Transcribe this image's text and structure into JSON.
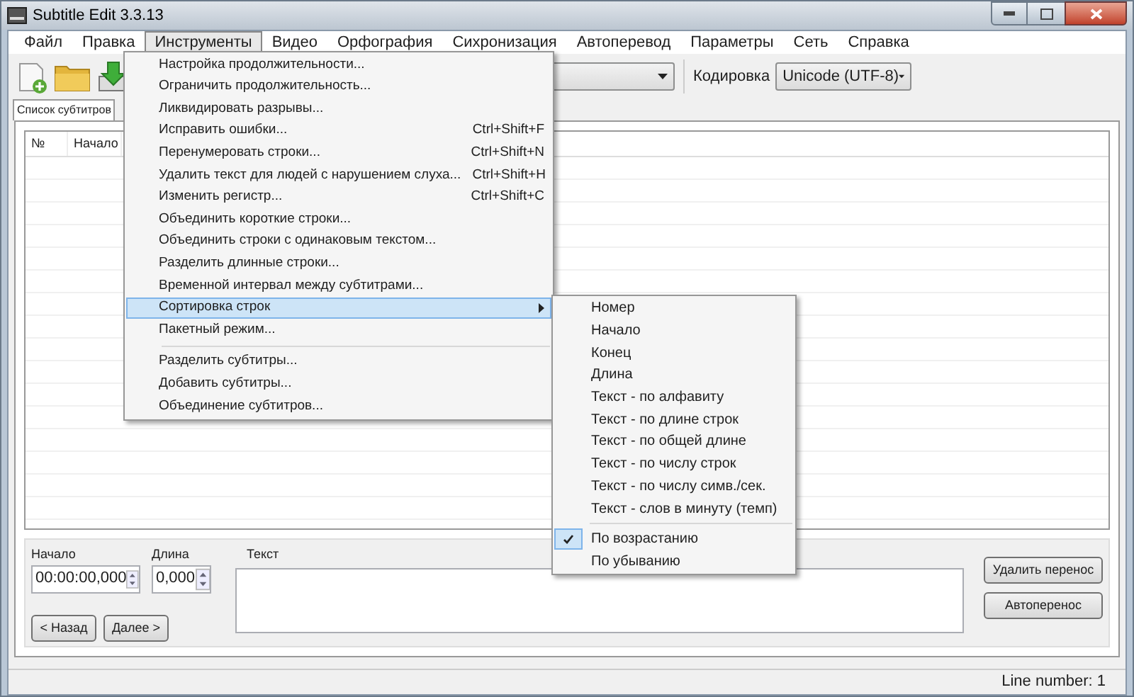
{
  "window": {
    "title": "Subtitle Edit 3.3.13"
  },
  "menu_bar": [
    {
      "label": "Файл",
      "selected": false
    },
    {
      "label": "Правка",
      "selected": false
    },
    {
      "label": "Инструменты",
      "selected": true
    },
    {
      "label": "Видео",
      "selected": false
    },
    {
      "label": "Орфография",
      "selected": false
    },
    {
      "label": "Сихронизация",
      "selected": false
    },
    {
      "label": "Автоперевод",
      "selected": false
    },
    {
      "label": "Параметры",
      "selected": false
    },
    {
      "label": "Сеть",
      "selected": false
    },
    {
      "label": "Справка",
      "selected": false
    }
  ],
  "toolbar": {
    "encoding_label": "Кодировка",
    "encoding_value": "Unicode (UTF-8)"
  },
  "tabs": [
    {
      "label": "Список субтитров",
      "selected": true
    }
  ],
  "table": {
    "columns": [
      "№",
      "Начало"
    ]
  },
  "edit_panel": {
    "start_label": "Начало",
    "start_value": "00:00:00,000",
    "duration_label": "Длина",
    "duration_value": "0,000",
    "text_label": "Текст",
    "prev_button": "< Назад",
    "next_button": "Далее >",
    "unbreak_button": "Удалить перенос",
    "autobreak_button": "Автоперенос"
  },
  "status_bar": "Line number: 1",
  "tools_menu": [
    {
      "kind": "item",
      "label": "Настройка продолжительности...",
      "selected": false
    },
    {
      "kind": "item",
      "label": "Ограничить продолжительность...",
      "selected": false
    },
    {
      "kind": "item",
      "label": "Ликвидировать разрывы...",
      "selected": false
    },
    {
      "kind": "item",
      "label": "Исправить ошибки...",
      "shortcut": "Ctrl+Shift+F",
      "selected": false
    },
    {
      "kind": "item",
      "label": "Перенумеровать строки...",
      "shortcut": "Ctrl+Shift+N",
      "selected": false
    },
    {
      "kind": "item",
      "label": "Удалить текст для людей с нарушением слуха...",
      "shortcut": "Ctrl+Shift+H",
      "selected": false
    },
    {
      "kind": "item",
      "label": "Изменить регистр...",
      "shortcut": "Ctrl+Shift+C",
      "selected": false
    },
    {
      "kind": "item",
      "label": "Объединить короткие строки...",
      "selected": false
    },
    {
      "kind": "item",
      "label": "Объединить строки с одинаковым текстом...",
      "selected": false
    },
    {
      "kind": "item",
      "label": "Разделить длинные строки...",
      "selected": false
    },
    {
      "kind": "item",
      "label": "Временной интервал между субтитрами...",
      "selected": false
    },
    {
      "kind": "submenu",
      "label": "Сортировка строк",
      "selected": true
    },
    {
      "kind": "item",
      "label": "Пакетный режим...",
      "selected": false
    },
    {
      "kind": "separator"
    },
    {
      "kind": "item",
      "label": "Разделить субтитры...",
      "selected": false
    },
    {
      "kind": "item",
      "label": "Добавить субтитры...",
      "selected": false
    },
    {
      "kind": "item",
      "label": "Объединение субтитров...",
      "selected": false
    }
  ],
  "sort_submenu": [
    {
      "kind": "item",
      "label": "Номер",
      "checked": false
    },
    {
      "kind": "item",
      "label": "Начало",
      "checked": false
    },
    {
      "kind": "item",
      "label": "Конец",
      "checked": false
    },
    {
      "kind": "item",
      "label": "Длина",
      "checked": false
    },
    {
      "kind": "item",
      "label": "Текст - по алфавиту",
      "checked": false
    },
    {
      "kind": "item",
      "label": "Текст - по длине строк",
      "checked": false
    },
    {
      "kind": "item",
      "label": "Текст - по общей длине",
      "checked": false
    },
    {
      "kind": "item",
      "label": "Текст - по числу строк",
      "checked": false
    },
    {
      "kind": "item",
      "label": "Текст - по числу симв./сек.",
      "checked": false
    },
    {
      "kind": "item",
      "label": "Текст - слов в минуту (темп)",
      "checked": false
    },
    {
      "kind": "separator"
    },
    {
      "kind": "item",
      "label": "По возрастанию",
      "checked": true
    },
    {
      "kind": "item",
      "label": "По убыванию",
      "checked": false
    }
  ]
}
